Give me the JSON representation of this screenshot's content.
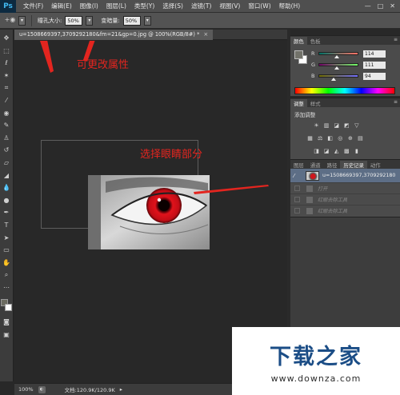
{
  "menubar": {
    "logo": "Ps",
    "items": [
      "文件(F)",
      "编辑(E)",
      "图像(I)",
      "图层(L)",
      "类型(Y)",
      "选择(S)",
      "滤镜(T)",
      "视图(V)",
      "窗口(W)",
      "帮助(H)"
    ],
    "minimize": "—",
    "restore": "□",
    "close": "✕"
  },
  "options": {
    "pupil_size_label": "瞳孔大小:",
    "pupil_size_value": "50%",
    "darken_label": "变暗量:",
    "darken_value": "50%"
  },
  "document": {
    "tab_title": "u=1508669397,3709292180&fm=21&gp=0.jpg @ 100%(RGB/8#) *",
    "tab_close": "×"
  },
  "annotations": {
    "editable_props": "可更改属性",
    "select_eye": "选择眼睛部分"
  },
  "status": {
    "zoom": "100%",
    "doc_info": "文档:120.9K/120.9K"
  },
  "color_panel": {
    "tabs": [
      "颜色",
      "色板"
    ],
    "sliders": [
      {
        "letter": "R",
        "value": "114",
        "fraction": 0.447,
        "gradient": "linear-gradient(90deg,#007266,#ff7266)"
      },
      {
        "letter": "G",
        "value": "111",
        "fraction": 0.435,
        "gradient": "linear-gradient(90deg,#720066,#72ff66)"
      },
      {
        "letter": "B",
        "value": "94",
        "fraction": 0.369,
        "gradient": "linear-gradient(90deg,#726f00,#726fff)"
      }
    ]
  },
  "adjust_panel": {
    "tabs": [
      "调整",
      "样式"
    ],
    "title": "添加调整"
  },
  "history_panel": {
    "tabs": [
      "图层",
      "通道",
      "路径",
      "历史记录",
      "动作"
    ],
    "snapshot_label": "u=1508669397,3709292180...",
    "steps": [
      "打开",
      "红眼去除工具",
      "红眼去除工具"
    ]
  },
  "watermark": {
    "main": "下载之家",
    "sub": "www.downza.com"
  }
}
